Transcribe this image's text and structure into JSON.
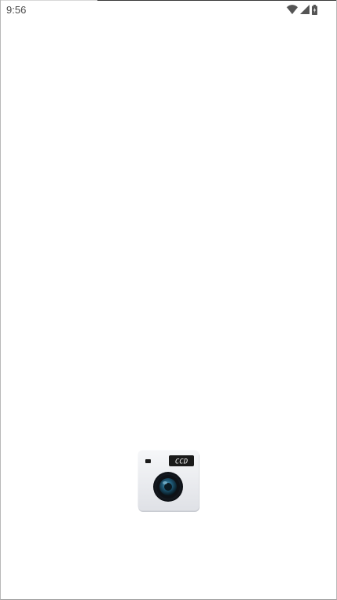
{
  "status_bar": {
    "time": "9:56",
    "icons": [
      "wifi-icon",
      "cellular-signal-icon",
      "battery-charging-icon"
    ]
  },
  "splash": {
    "logo_icon": "camera-app-icon",
    "logo_display_text": "CCD"
  },
  "colors": {
    "background": "#ffffff",
    "status_text": "#4a4a4a",
    "status_icon": "#555555",
    "logo_body": "#eceef2",
    "logo_display": "#1a1a1a"
  }
}
